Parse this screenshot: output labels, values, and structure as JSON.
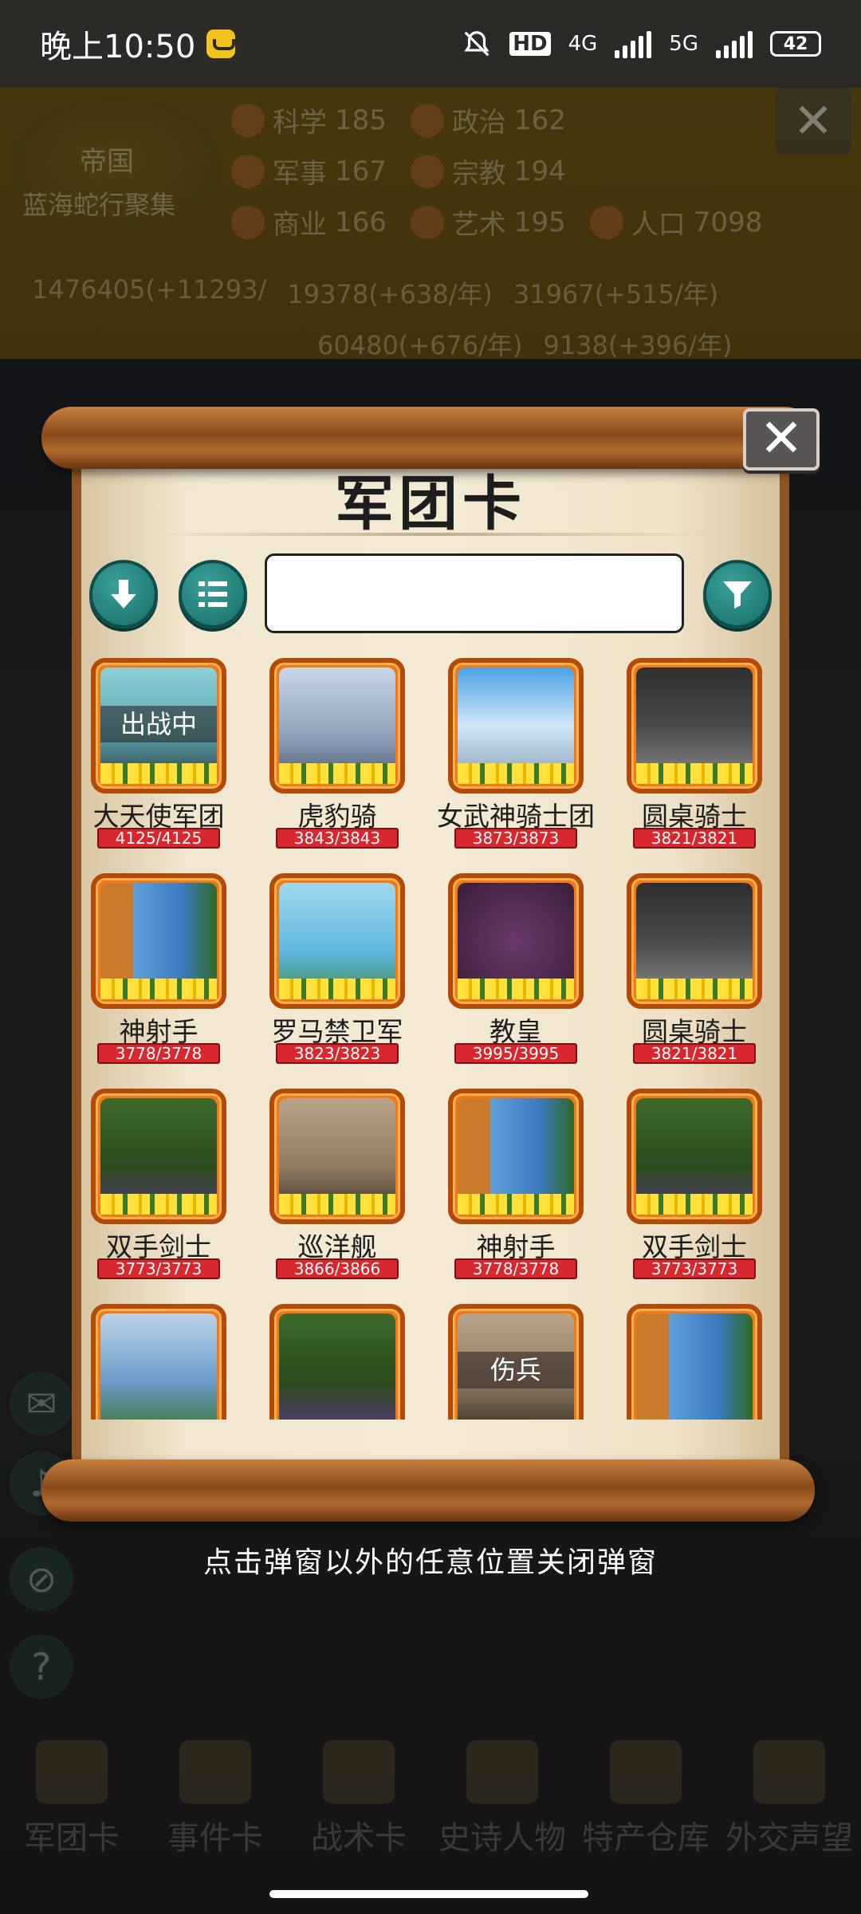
{
  "status_bar": {
    "time": "晚上10:50",
    "hd": "HD",
    "net1": "4G",
    "net2": "5G",
    "battery": "42"
  },
  "background": {
    "emblem_title": "帝国",
    "emblem_subtitle": "蓝海蛇行聚集",
    "stats": [
      {
        "label": "科学",
        "value": "185"
      },
      {
        "label": "政治",
        "value": "162"
      },
      {
        "label": "军事",
        "value": "167"
      },
      {
        "label": "宗教",
        "value": "194"
      },
      {
        "label": "商业",
        "value": "166"
      },
      {
        "label": "艺术",
        "value": "195"
      },
      {
        "label": "人口",
        "value": "7098"
      }
    ],
    "resources": [
      "1476405(+11293/",
      "19378(+638/年)",
      "31967(+515/年)",
      "60480(+676/年)",
      "9138(+396/年)"
    ],
    "bottom_nav": [
      "军团卡",
      "事件卡",
      "战术卡",
      "史诗人物",
      "特产仓库",
      "外交声望"
    ]
  },
  "dialog": {
    "title": "军团卡",
    "close_symbol": "✕",
    "search_placeholder": "",
    "cards": [
      {
        "name": "大天使军团",
        "hp": "4125/4125",
        "tag": "出战中",
        "art": "angel"
      },
      {
        "name": "虎豹骑",
        "hp": "3843/3843",
        "tag": "",
        "art": "cavalry"
      },
      {
        "name": "女武神骑士团",
        "hp": "3873/3873",
        "tag": "",
        "art": "valkyrie"
      },
      {
        "name": "圆桌骑士",
        "hp": "3821/3821",
        "tag": "",
        "art": "knight"
      },
      {
        "name": "神射手",
        "hp": "3778/3778",
        "tag": "",
        "art": "archer"
      },
      {
        "name": "罗马禁卫军",
        "hp": "3823/3823",
        "tag": "",
        "art": "roman"
      },
      {
        "name": "教皇",
        "hp": "3995/3995",
        "tag": "",
        "art": "pope"
      },
      {
        "name": "圆桌骑士",
        "hp": "3821/3821",
        "tag": "",
        "art": "knight"
      },
      {
        "name": "双手剑士",
        "hp": "3773/3773",
        "tag": "",
        "art": "swordsman"
      },
      {
        "name": "巡洋舰",
        "hp": "3866/3866",
        "tag": "",
        "art": "ship"
      },
      {
        "name": "神射手",
        "hp": "3778/3778",
        "tag": "",
        "art": "archer"
      },
      {
        "name": "双手剑士",
        "hp": "3773/3773",
        "tag": "",
        "art": "swordsman"
      },
      {
        "name": "",
        "hp": "",
        "tag": "",
        "art": "archer2"
      },
      {
        "name": "",
        "hp": "",
        "tag": "",
        "art": "swordsman"
      },
      {
        "name": "",
        "hp": "",
        "tag": "伤兵",
        "art": "ship"
      },
      {
        "name": "",
        "hp": "",
        "tag": "",
        "art": "archer"
      }
    ],
    "footer_hint": "点击弹窗以外的任意位置关闭弹窗"
  },
  "colors": {
    "card_border": "#f07a1a",
    "hp_bar": "#d8272d",
    "teal_button": "#1f8a84",
    "paper": "#f4ead5"
  }
}
